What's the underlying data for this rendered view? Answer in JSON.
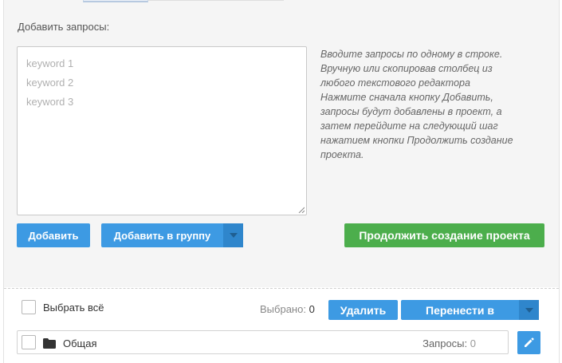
{
  "add_queries": {
    "label": "Добавить запросы:",
    "placeholder_lines": [
      "keyword 1",
      "keyword 2",
      "keyword 3"
    ]
  },
  "hint": {
    "paragraph1": "Вводите запросы по одному в строке. Вручную или скопировав столбец из любого текстового редактора",
    "paragraph2": "Нажмите сначала кнопку Добавить, запросы будут добавлены в проект, а затем перейдите на следующий шаг нажатием кнопки Продолжить создание проекта."
  },
  "buttons": {
    "add": "Добавить",
    "add_to_group": "Добавить в группу",
    "continue": "Продолжить создание проекта",
    "delete": "Удалить",
    "move_to": "Перенести в"
  },
  "selection": {
    "select_all": "Выбрать всё",
    "selected_label": "Выбрано:",
    "selected_count": "0"
  },
  "group": {
    "name": "Общая",
    "queries_label": "Запросы:",
    "queries_count": "0"
  },
  "icons": {
    "folder": "folder-icon",
    "edit": "pencil-icon",
    "dropdown": "caret-down-icon"
  },
  "colors": {
    "primary_blue": "#3d9ae3",
    "dropdown_blue": "#2f86cc",
    "success_green": "#4cae4c",
    "panel_bg": "#f5f5f5"
  }
}
